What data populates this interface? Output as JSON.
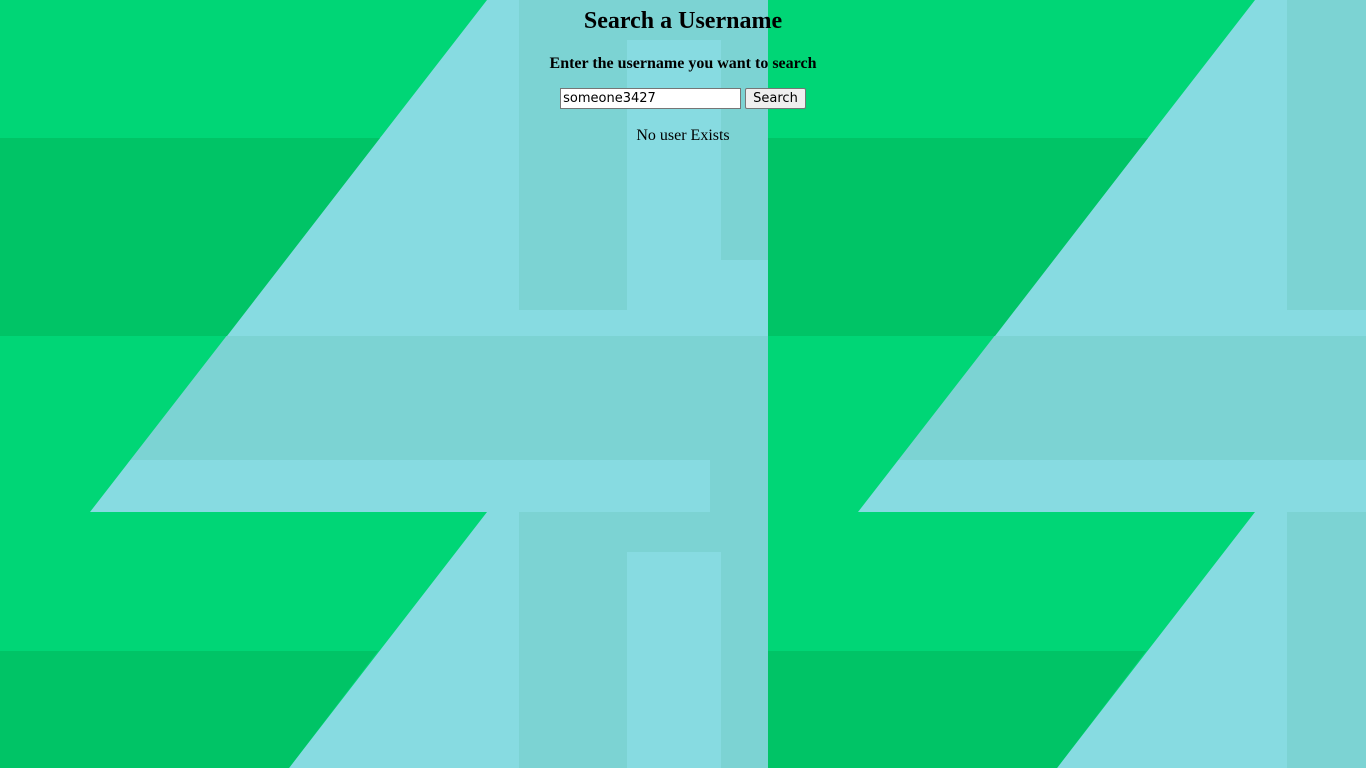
{
  "page": {
    "title": "Search a Username",
    "subtitle": "Enter the username you want to search"
  },
  "search": {
    "input_value": "someone3427",
    "button_label": "Search"
  },
  "result": {
    "message": "No user Exists"
  },
  "colors": {
    "green_light": "#00d676",
    "green_dark": "#00c466",
    "cyan_light": "#87dbe1",
    "cyan_dark": "#7cd3d3"
  }
}
